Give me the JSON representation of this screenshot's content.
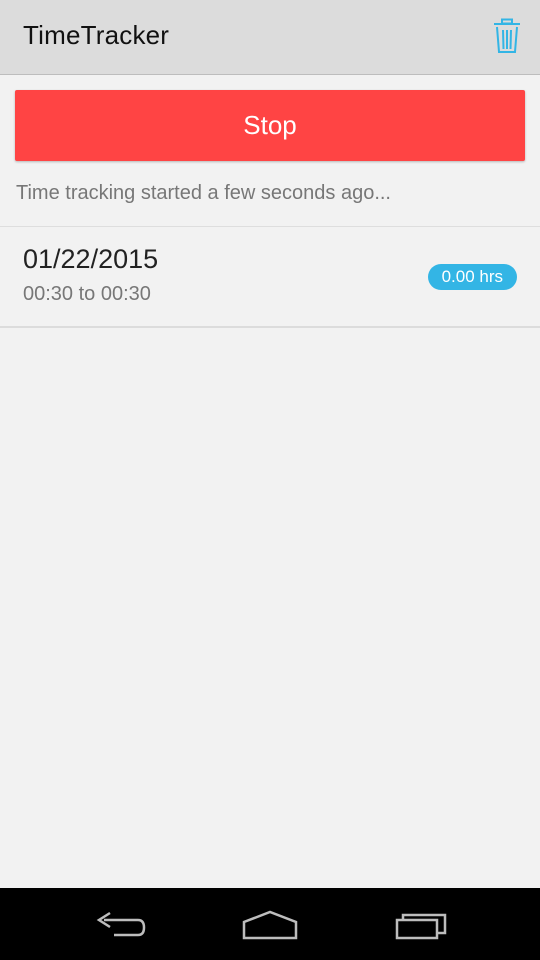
{
  "app_bar": {
    "title": "TimeTracker",
    "delete_icon": "trash-icon",
    "accent_color": "#33b5e5"
  },
  "stop_button": {
    "label": "Stop",
    "color": "#ff4444"
  },
  "status": {
    "text": "Time tracking started a few seconds ago..."
  },
  "entries": [
    {
      "date": "01/22/2015",
      "range": "00:30 to 00:30",
      "hours": "0.00 hrs"
    }
  ],
  "nav_bar": {
    "back_icon": "back-icon",
    "home_icon": "home-icon",
    "recents_icon": "recents-icon"
  }
}
